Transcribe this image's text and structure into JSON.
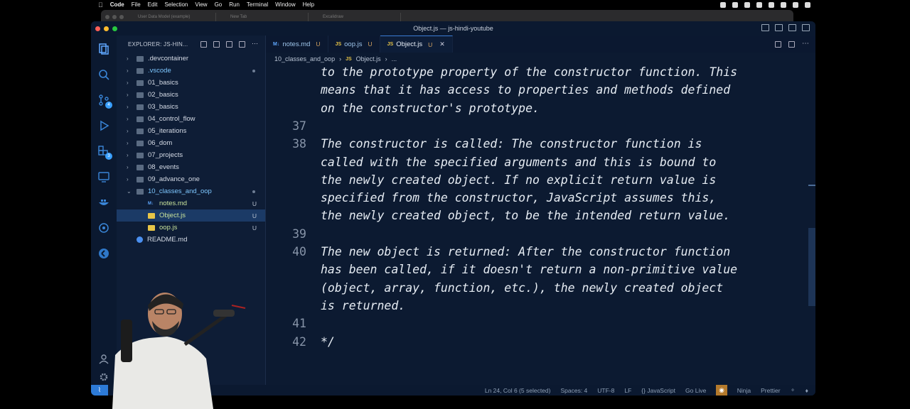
{
  "menubar": {
    "app": "Code",
    "items": [
      "File",
      "Edit",
      "Selection",
      "View",
      "Go",
      "Run",
      "Terminal",
      "Window",
      "Help"
    ]
  },
  "browser_bg": {
    "tabs": [
      "User Data Model (example)",
      "New Tab",
      "Excalidraw"
    ]
  },
  "window": {
    "title": "Object.js — js-hindi-youtube"
  },
  "activity": {
    "badges": {
      "source_control": "4",
      "extensions": "3"
    }
  },
  "sidebar": {
    "header": "EXPLORER: JS-HIN...",
    "items": [
      {
        "label": ".devcontainer",
        "kind": "folder",
        "depth": 1
      },
      {
        "label": ".vscode",
        "kind": "folder",
        "depth": 1,
        "dot": true
      },
      {
        "label": "01_basics",
        "kind": "folder",
        "depth": 1
      },
      {
        "label": "02_basics",
        "kind": "folder",
        "depth": 1
      },
      {
        "label": "03_basics",
        "kind": "folder",
        "depth": 1
      },
      {
        "label": "04_control_flow",
        "kind": "folder",
        "depth": 1
      },
      {
        "label": "05_iterations",
        "kind": "folder",
        "depth": 1
      },
      {
        "label": "06_dom",
        "kind": "folder",
        "depth": 1
      },
      {
        "label": "07_projects",
        "kind": "folder",
        "depth": 1
      },
      {
        "label": "08_events",
        "kind": "folder",
        "depth": 1
      },
      {
        "label": "09_advance_one",
        "kind": "folder",
        "depth": 1
      },
      {
        "label": "10_classes_and_oop",
        "kind": "folder-open",
        "depth": 1,
        "dot": true
      },
      {
        "label": "notes.md",
        "kind": "md",
        "depth": 2,
        "status": "U"
      },
      {
        "label": "Object.js",
        "kind": "js",
        "depth": 2,
        "status": "U",
        "selected": true
      },
      {
        "label": "oop.js",
        "kind": "js",
        "depth": 2,
        "status": "U"
      },
      {
        "label": "README.md",
        "kind": "info",
        "depth": 1
      }
    ]
  },
  "tabs": [
    {
      "label": "notes.md",
      "icon": "M↓",
      "kind": "md",
      "mod": "U"
    },
    {
      "label": "oop.js",
      "icon": "JS",
      "kind": "js",
      "mod": "U"
    },
    {
      "label": "Object.js",
      "icon": "JS",
      "kind": "js",
      "mod": "U",
      "active": true,
      "close": "✕"
    }
  ],
  "breadcrumb": {
    "folder": "10_classes_and_oop",
    "file": "Object.js",
    "rest": "..."
  },
  "code_lines": [
    {
      "num": "",
      "text": "to the prototype property of the constructor function. This"
    },
    {
      "num": "",
      "text": "means that it has access to properties and methods defined"
    },
    {
      "num": "",
      "text": "on the constructor's prototype."
    },
    {
      "num": "37",
      "text": ""
    },
    {
      "num": "38",
      "text": "The constructor is called: The constructor function is"
    },
    {
      "num": "",
      "text": "called with the specified arguments and this is bound to"
    },
    {
      "num": "",
      "text": "the newly created object. If no explicit return value is"
    },
    {
      "num": "",
      "text": "specified from the constructor, JavaScript assumes this,"
    },
    {
      "num": "",
      "text": "the newly created object, to be the intended return value."
    },
    {
      "num": "39",
      "text": ""
    },
    {
      "num": "40",
      "text": "The new object is returned: After the constructor function"
    },
    {
      "num": "",
      "text": "has been called, if it doesn't return a non-primitive value"
    },
    {
      "num": "",
      "text": "(object, array, function, etc.), the newly created object"
    },
    {
      "num": "",
      "text": "is returned."
    },
    {
      "num": "41",
      "text": ""
    },
    {
      "num": "42",
      "text": "*/"
    }
  ],
  "statusbar": {
    "cursor": "Ln 24, Col 6 (5 selected)",
    "spaces": "Spaces: 4",
    "encoding": "UTF-8",
    "eol": "LF",
    "language": "{} JavaScript",
    "golive": "Go Live",
    "ninja": "Ninja",
    "prettier": "Prettier"
  }
}
